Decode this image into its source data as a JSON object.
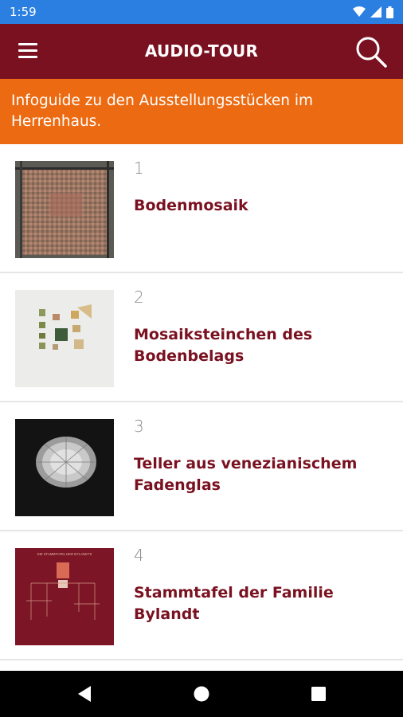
{
  "status_bar": {
    "time": "1:59"
  },
  "app_bar": {
    "title": "AUDIO-TOUR",
    "menu_icon": "menu-icon",
    "search_icon": "search-icon"
  },
  "banner": {
    "text": "Infoguide zu den Ausstellungsstücken im Herrenhaus."
  },
  "items": [
    {
      "number": "1",
      "title": "Bodenmosaik"
    },
    {
      "number": "2",
      "title": "Mosaiksteinchen des Bodenbelags"
    },
    {
      "number": "3",
      "title": "Teller aus venezianischem Fadenglas"
    },
    {
      "number": "4",
      "title": "Stammtafel der Familie Bylandt",
      "thumb_caption": "DIE STAMMTAFEL DER BYLANDTS"
    }
  ],
  "colors": {
    "status_bar": "#2a7fe0",
    "app_bar": "#7a1120",
    "banner": "#ec6b12",
    "title_text": "#7a1120",
    "nav_bar": "#000000"
  }
}
